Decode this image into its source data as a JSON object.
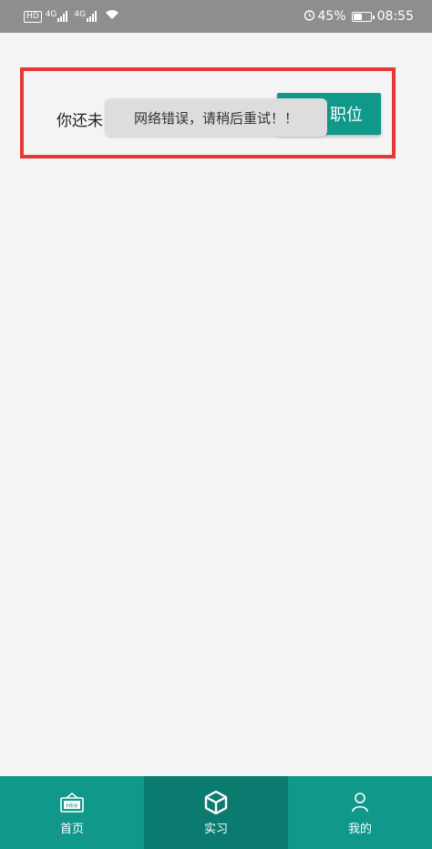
{
  "status_bar": {
    "hd": "HD",
    "signal_1": "4G",
    "signal_2": "4G",
    "battery": "45%",
    "time": "08:55"
  },
  "content": {
    "notice_text": "你还未",
    "post_button_label": "职位",
    "toast": "网络错误，请稍后重试！！"
  },
  "bottom_nav": {
    "items": [
      {
        "label": "首页",
        "icon": "home-hire-icon"
      },
      {
        "label": "实习",
        "icon": "box-icon"
      },
      {
        "label": "我的",
        "icon": "person-icon"
      }
    ],
    "active": "实习"
  },
  "colors": {
    "accent": "#10988a",
    "accent_dark": "#0b7b6f",
    "highlight": "#e53935",
    "background": "#f4f4f4",
    "status_bar": "#8e8e8e"
  }
}
